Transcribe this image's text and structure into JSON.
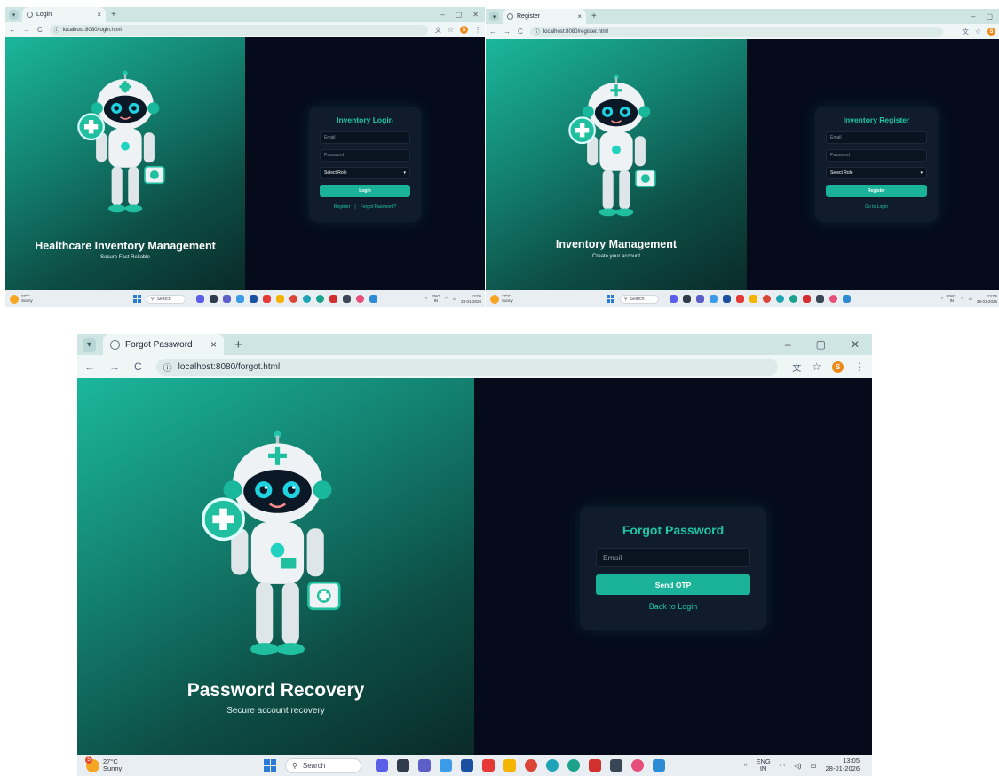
{
  "login": {
    "tab_title": "Login",
    "url": "localhost:8080/login.html",
    "left_title": "Healthcare Inventory Management",
    "left_subtitle": "Secure Fast Reliable",
    "card_title": "Inventory Login",
    "email_placeholder": "Email",
    "password_placeholder": "Password",
    "role_value": "Select Role",
    "button_label": "Login",
    "link_register": "Register",
    "link_separator": "|",
    "link_forgot": "Forgot Password?"
  },
  "register": {
    "tab_title": "Register",
    "url": "localhost:8080/register.html",
    "left_title": "Inventory Management",
    "left_subtitle": "Create your account",
    "card_title": "Inventory Register",
    "email_placeholder": "Email",
    "password_placeholder": "Password",
    "role_value": "Select Role",
    "button_label": "Register",
    "link_login": "Go to Login"
  },
  "forgot": {
    "tab_title": "Forgot Password",
    "url": "localhost:8080/forgot.html",
    "left_title": "Password Recovery",
    "left_subtitle": "Secure account recovery",
    "card_title": "Forgot Password",
    "email_placeholder": "Email",
    "button_label": "Send OTP",
    "link_login": "Back to Login"
  },
  "browser": {
    "new_tab": "+",
    "tab_close": "×",
    "minimize": "–",
    "restore": "▢",
    "close": "✕",
    "back": "←",
    "forward": "→",
    "reload": "C",
    "info": "ⓘ",
    "star": "☆",
    "menu": "⋮",
    "translate_icon": "translate-icon",
    "profile_initial": "S",
    "accent": "#1ab39a",
    "title_color": "#1ec5a7"
  },
  "taskbar": {
    "temperature": "27°C",
    "condition": "Sunny",
    "weather_badge": "5",
    "search_label": "Search",
    "lang_top": "ENG",
    "lang_bottom": "IN",
    "time": "13:05",
    "date": "28-01-2026",
    "apps": [
      {
        "name": "chat-app-icon",
        "color": "#5a5ee8"
      },
      {
        "name": "file-explorer-icon",
        "color": "#2f3b4a"
      },
      {
        "name": "teams-icon",
        "color": "#5b5fc7"
      },
      {
        "name": "copilot-icon",
        "color": "#3b9be8"
      },
      {
        "name": "store-icon",
        "color": "#1b4fa0"
      },
      {
        "name": "office-icon",
        "color": "#e53935"
      },
      {
        "name": "folder-icon",
        "color": "#f4b400"
      },
      {
        "name": "chrome-icon",
        "color": "#db4437"
      },
      {
        "name": "edge-icon",
        "color": "#1fa3b6"
      },
      {
        "name": "browser-icon",
        "color": "#1aa28a"
      },
      {
        "name": "security-icon",
        "color": "#d32f2f"
      },
      {
        "name": "terminal-icon",
        "color": "#3a4556"
      },
      {
        "name": "paint-icon",
        "color": "#e84e7a"
      },
      {
        "name": "vscode-icon",
        "color": "#2d8bd6"
      }
    ]
  }
}
